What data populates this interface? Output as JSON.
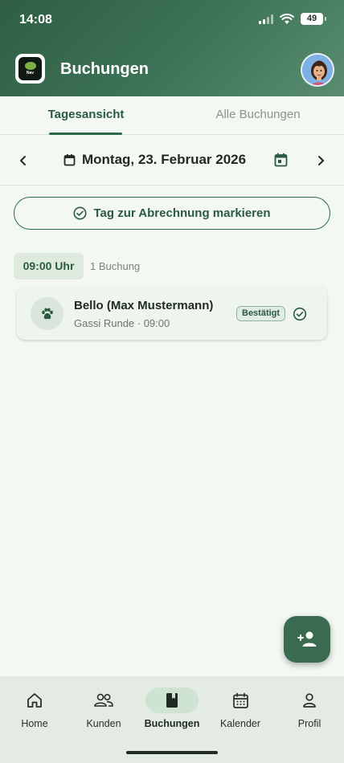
{
  "status_bar": {
    "time": "14:08",
    "battery": "49"
  },
  "app": {
    "logo_text": "Nav",
    "title": "Buchungen"
  },
  "tabs": [
    {
      "label": "Tagesansicht",
      "active": true
    },
    {
      "label": "Alle Buchungen",
      "active": false
    }
  ],
  "date_nav": {
    "date": "Montag, 23. Februar 2026"
  },
  "actions": {
    "mark_day_label": "Tag zur Abrechnung markieren"
  },
  "group": {
    "time": "09:00 Uhr",
    "count": "1 Buchung"
  },
  "booking": {
    "title": "Bello (Max Mustermann)",
    "subtitle": "Gassi Runde · 09:00",
    "status": "Bestätigt",
    "icon": "paw-icon"
  },
  "bottom_nav": [
    {
      "label": "Home",
      "icon": "home-icon"
    },
    {
      "label": "Kunden",
      "icon": "people-icon"
    },
    {
      "label": "Buchungen",
      "icon": "book-icon",
      "active": true
    },
    {
      "label": "Kalender",
      "icon": "calendar-icon"
    },
    {
      "label": "Profil",
      "icon": "person-icon"
    }
  ],
  "colors": {
    "primary": "#2f6b4a",
    "header": "#3e7457",
    "background": "#f3f8f3",
    "fab": "#3a6a4f"
  }
}
